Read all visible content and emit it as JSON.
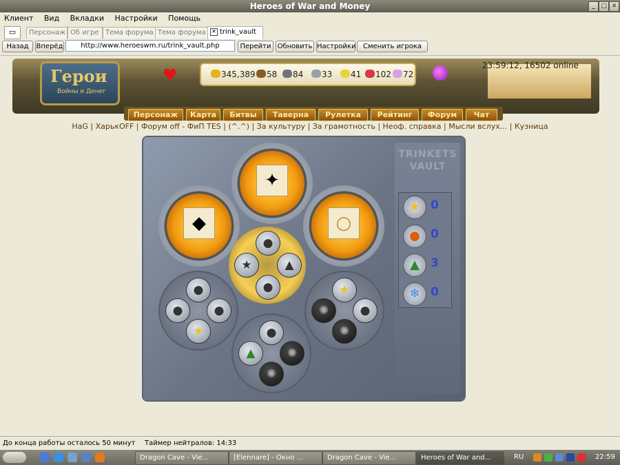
{
  "window": {
    "title": "Heroes of War and Money"
  },
  "menu": [
    "Клиент",
    "Вид",
    "Вкладки",
    "Настройки",
    "Помощь"
  ],
  "tabs": [
    {
      "label": "Персонаж"
    },
    {
      "label": "Об игре"
    },
    {
      "label": "Тема форума"
    },
    {
      "label": "Тема форума"
    },
    {
      "label": "trink_vault",
      "active": true
    }
  ],
  "nav": {
    "back": "Назад",
    "forward": "Вперёд",
    "url": "http://www.heroeswm.ru/trink_vault.php",
    "go": "Перейти",
    "refresh": "Обновить",
    "settings": "Настройки",
    "switch_player": "Сменить игрока"
  },
  "header": {
    "logo_title": "Герои",
    "logo_subtitle": "Войны и Денег",
    "clock": "23:59:12, 16502 online",
    "resources": [
      {
        "icon": "gold-icon",
        "value": "345,389",
        "color": "#e3b21c"
      },
      {
        "icon": "wood-icon",
        "value": "58",
        "color": "#8a5a2a"
      },
      {
        "icon": "ore-icon",
        "value": "84",
        "color": "#6d7480"
      },
      {
        "icon": "mercury-icon",
        "value": "33",
        "color": "#9aa0a8"
      },
      {
        "icon": "sulfur-icon",
        "value": "41",
        "color": "#e7d23a"
      },
      {
        "icon": "crystal-icon",
        "value": "102",
        "color": "#d8384a"
      },
      {
        "icon": "gems-icon",
        "value": "72",
        "color": "#d5a0e8"
      }
    ],
    "nav_items": [
      "Персонаж",
      "Карта",
      "Битвы",
      "Таверна",
      "Рулетка",
      "Рейтинг",
      "Форум",
      "Чат"
    ]
  },
  "links": "HaG | ХарькOFF | Форум off - ФиП TES | (^.^) | За культуру | За грамотность | Неоф. справка | Мысли вслух... | Кузница",
  "vault": {
    "title": "TRINKETS VAULT",
    "counters": [
      {
        "icon": "star-icon",
        "count": "0"
      },
      {
        "icon": "pumpkin-icon",
        "count": "0"
      },
      {
        "icon": "tree-icon",
        "count": "3"
      },
      {
        "icon": "snowflake-icon",
        "count": "0"
      }
    ]
  },
  "status": {
    "left": "До конца работы осталось 50 минут",
    "right": "Таймер нейтралов: 14:33"
  },
  "taskbar": {
    "tasks": [
      "Dragon Cave - Vie...",
      "[Elennare] - Окно ...",
      "Dragon Cave - Vie...",
      "Heroes of War and..."
    ],
    "lang": "RU",
    "time": "22:59"
  }
}
